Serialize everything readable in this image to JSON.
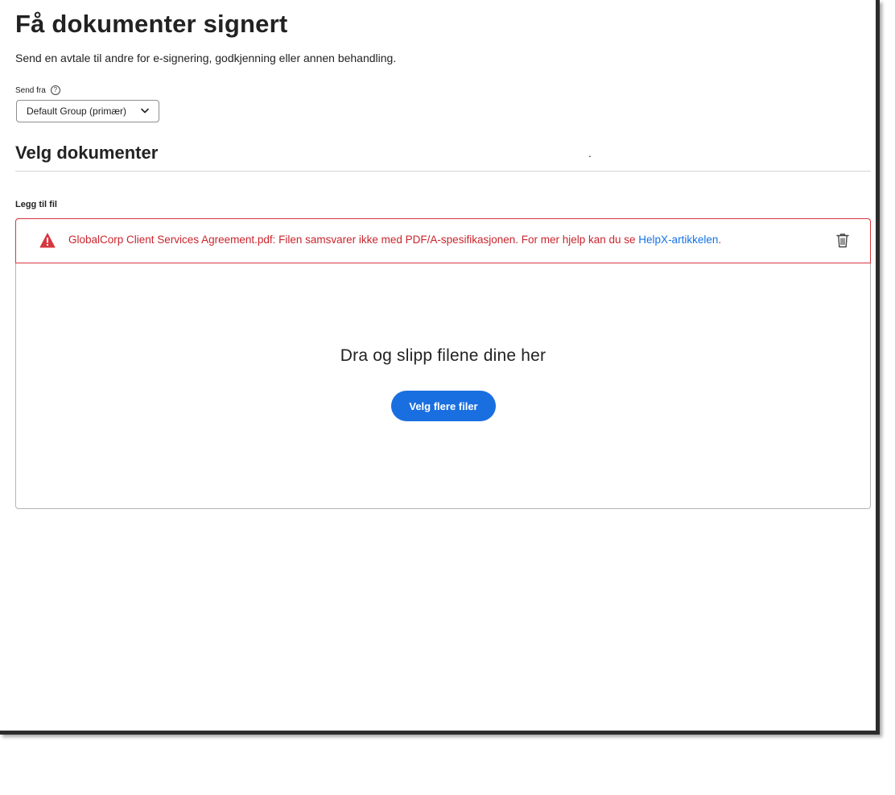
{
  "header": {
    "title": "Få dokumenter signert",
    "subtitle": "Send en avtale til andre for e-signering, godkjenning eller annen behandling."
  },
  "send_from": {
    "label": "Send fra",
    "help_glyph": "?",
    "selected_value": "Default Group (primær)"
  },
  "documents_section": {
    "title": "Velg dokumenter",
    "stray_mark": ".",
    "add_file_label": "Legg til fil"
  },
  "error": {
    "message": "GlobalCorp Client Services Agreement.pdf: Filen samsvarer ikke med PDF/A-spesifikasjonen. For mer hjelp kan du se ",
    "link_text": "HelpX-artikkelen",
    "trailing": ".",
    "color": "#c9252d",
    "icon": "alert-triangle-icon"
  },
  "dropzone": {
    "heading": "Dra og slipp filene dine her",
    "button_label": "Velg flere filer"
  },
  "colors": {
    "accent": "#1a6fe0",
    "link": "#1473e6",
    "error": "#d7373f"
  }
}
